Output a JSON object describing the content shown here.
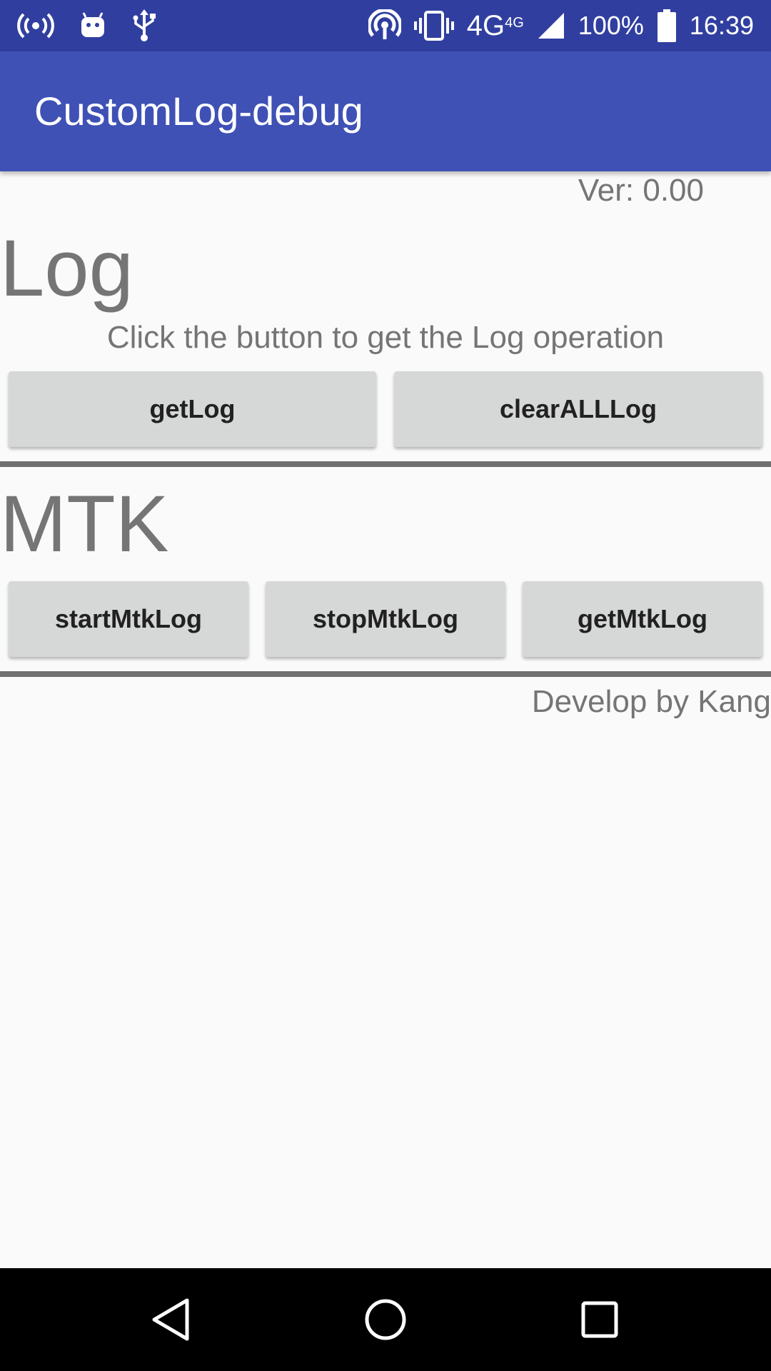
{
  "status_bar": {
    "icons": [
      "hotspot-icon",
      "android-debug-icon",
      "usb-icon",
      "wifi-tethering-icon",
      "vibrate-icon",
      "signal-icon",
      "battery-icon"
    ],
    "network": "4G",
    "network_small": "4G",
    "battery": "100%",
    "time": "16:39"
  },
  "app_bar": {
    "title": "CustomLog-debug",
    "color": "#3f51b5"
  },
  "version": "Ver: 0.00",
  "log_section": {
    "title": "Log",
    "hint": "Click the button to get the Log operation",
    "buttons": {
      "get_log": "getLog",
      "clear_all_log": "clearALLLog"
    }
  },
  "mtk_section": {
    "title": "MTK",
    "buttons": {
      "start": "startMtkLog",
      "stop": "stopMtkLog",
      "get": "getMtkLog"
    }
  },
  "credit": "Develop by Kang",
  "nav_bar": {
    "icons": [
      "back-icon",
      "home-icon",
      "recents-icon"
    ]
  }
}
